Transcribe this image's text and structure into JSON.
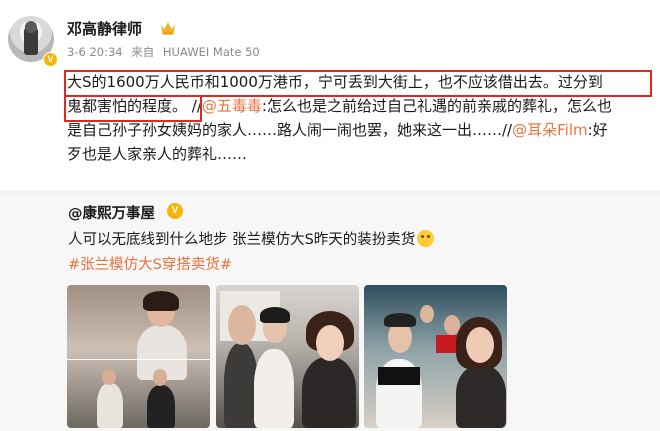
{
  "post": {
    "author": "邓高静律师",
    "time": "3-6 20:34",
    "source_prefix": "来自",
    "source_device": "HUAWEI Mate 50",
    "lines": {
      "l1": "大S的1600万人民币和1000万港币，宁可丢到大街上，也不应该借出去。过分到",
      "l2a": "鬼都害怕的程度。",
      "l2b": " //",
      "l2c": "@五毒毒",
      "l2d": ":怎么也是之前给过自己礼遇的前亲戚的葬礼，怎么也",
      "l3a": "是自己孙子孙女姨妈的家人……路人闹一闹也罢，她来这一出……//",
      "l3b": "@耳朵Film",
      "l3c": ":好",
      "l4": "歹也是人家亲人的葬礼……"
    }
  },
  "repost": {
    "author": "@康熙万事屋",
    "text": "人可以无底线到什么地步 张兰模仿大S昨天的装扮卖货",
    "hashtag": "#张兰模仿大S穿搭卖货#"
  },
  "colors": {
    "link": "#eb7340",
    "highlight_box": "#e0281e",
    "verified_badge": "#f6b500"
  }
}
